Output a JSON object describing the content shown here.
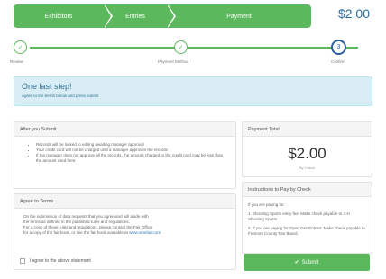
{
  "breadcrumb": {
    "items": [
      {
        "label": "Exhibitors"
      },
      {
        "label": "Entries"
      },
      {
        "label": "Payment"
      }
    ]
  },
  "header": {
    "price": "$2.00"
  },
  "steps": [
    {
      "label": "Review",
      "glyph": "✓"
    },
    {
      "label": "Payment Method",
      "glyph": "✓"
    },
    {
      "label": "Confirm",
      "glyph": "3"
    }
  ],
  "alert": {
    "title": "One last step!",
    "text": "Agree to the terms below and press submit"
  },
  "after_submit": {
    "heading": "After you Submit",
    "bullets": [
      "Records will be locked to editing awaiting manager approval",
      "Your credit card will not be charged until a manager approves the records",
      "If the manager does not approve all the records, the amount charged to the credit card may be less than the amount cited here"
    ]
  },
  "terms": {
    "heading": "Agree to Terms",
    "lines": [
      "On the submission of data requests that you agree and will abide with",
      "the terms as defined in the published rules and regulations.",
      "For a copy of these rules and regulations, please contact the Fair Office"
    ],
    "last_line_prefix": "for a copy of the fair book, or see the fair book available at",
    "link_text": "www.smefair.com",
    "agree_label": "I agree to the above statement"
  },
  "payment_total": {
    "heading": "Payment Total",
    "amount": "$2.00",
    "method": "By Check"
  },
  "instructions": {
    "heading": "Instructions to Pay by Check",
    "paragraphs": [
      "If you are paying for:",
      "1. Shooting Sports entry fee: Make check payable to 4-H Shooting Sports.",
      "2. If you are paying for Open Fair Entries: Make check payable to Fremont County Fair Board."
    ]
  },
  "submit": {
    "label": "Submit",
    "icon": "check-circle-icon"
  },
  "colors": {
    "success": "#5cb85c",
    "info_bg": "#d9edf7",
    "price": "#2e6e9e",
    "active_step": "#2e5fa0"
  }
}
